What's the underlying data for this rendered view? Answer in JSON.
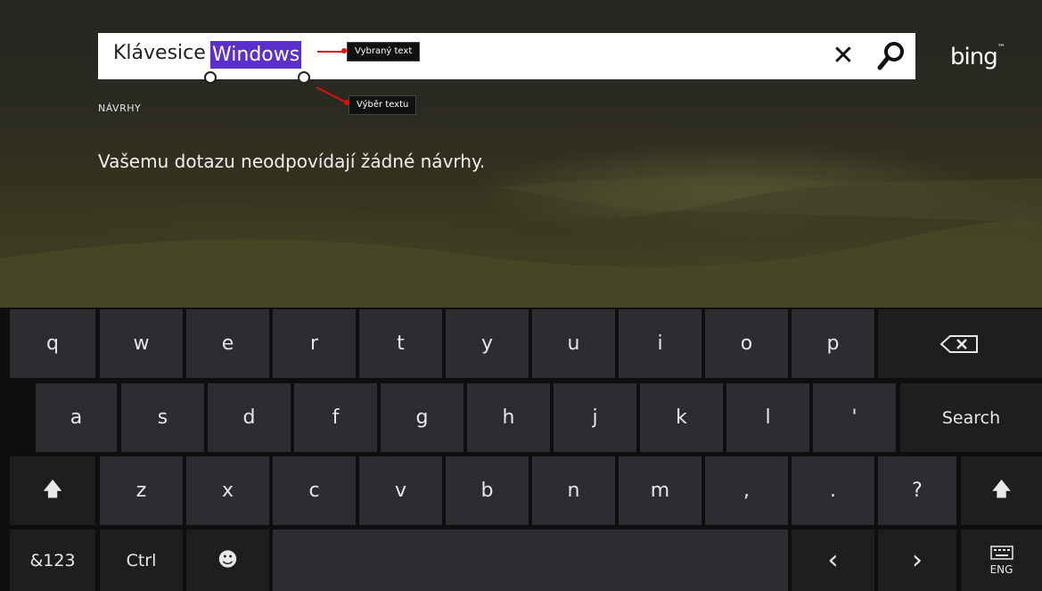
{
  "search": {
    "query_prefix": "Klávesice ",
    "query_selected": "Windows",
    "clear_glyph": "✕",
    "search_icon": "search-icon"
  },
  "brand": {
    "logo": "bing",
    "trademark": "™"
  },
  "suggestions": {
    "label": "NÁVRHY",
    "empty_message": "Vašemu dotazu neodpovídají žádné návrhy."
  },
  "annotations": {
    "selected_text": "Vybraný text",
    "text_selection": "Výběr textu"
  },
  "keyboard": {
    "row1": [
      "q",
      "w",
      "e",
      "r",
      "t",
      "y",
      "u",
      "i",
      "o",
      "p"
    ],
    "backspace": "⌫",
    "row2": [
      "a",
      "s",
      "d",
      "f",
      "g",
      "h",
      "j",
      "k",
      "l",
      "'"
    ],
    "search": "Search",
    "shift": "🡅",
    "row3": [
      "z",
      "x",
      "c",
      "v",
      "b",
      "n",
      "m",
      ",",
      ".",
      "?"
    ],
    "symbols": "&123",
    "ctrl": "Ctrl",
    "emoji": "☻",
    "left": "‹",
    "right": "›",
    "language": "ENG"
  },
  "colors": {
    "selection": "#5b2fc9",
    "callout_arrow": "#dd1111",
    "key": "#2d2c30",
    "key_dark": "#1e1e1f"
  }
}
